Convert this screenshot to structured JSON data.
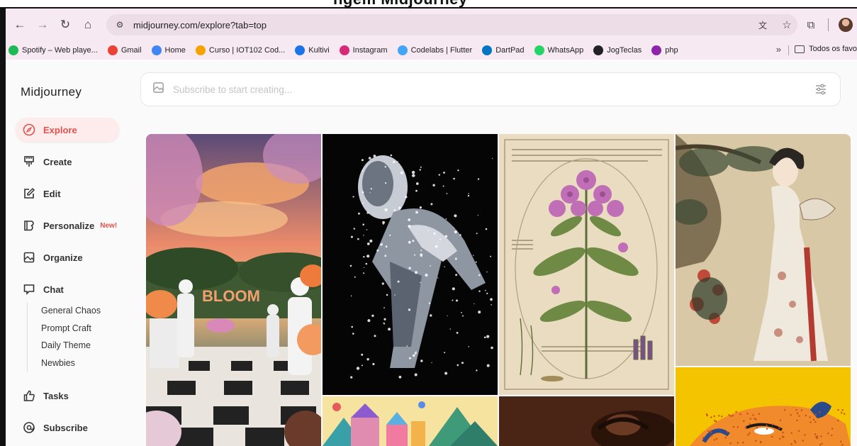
{
  "browser": {
    "url": "midjourney.com/explore?tab=top",
    "bookmarks": [
      {
        "label": "Spotify – Web playe...",
        "color": "#1db954"
      },
      {
        "label": "Gmail",
        "color": "#ea4335"
      },
      {
        "label": "Home",
        "color": "#4285f4"
      },
      {
        "label": "Curso | IOT102 Cod...",
        "color": "#f4a300"
      },
      {
        "label": "Kultivi",
        "color": "#1a73e8"
      },
      {
        "label": "Instagram",
        "color": "#d62976"
      },
      {
        "label": "Codelabs | Flutter",
        "color": "#42a5f5"
      },
      {
        "label": "DartPad",
        "color": "#0175c2"
      },
      {
        "label": "WhatsApp",
        "color": "#25d366"
      },
      {
        "label": "JogTeclas",
        "color": "#222222"
      },
      {
        "label": "php",
        "color": "#8e24aa"
      }
    ],
    "more": "»",
    "folder_label": "Todos os favo"
  },
  "sidebar": {
    "brand": "Midjourney",
    "items": [
      {
        "label": "Explore",
        "icon": "compass-icon"
      },
      {
        "label": "Create",
        "icon": "brush-icon"
      },
      {
        "label": "Edit",
        "icon": "edit-icon"
      },
      {
        "label": "Personalize",
        "icon": "personalize-icon",
        "badge": "New!"
      },
      {
        "label": "Organize",
        "icon": "image-icon"
      },
      {
        "label": "Chat",
        "icon": "chat-icon"
      },
      {
        "label": "Tasks",
        "icon": "thumbs-up-icon"
      },
      {
        "label": "Subscribe",
        "icon": "at-icon"
      }
    ],
    "chat_channels": [
      "General Chaos",
      "Prompt Craft",
      "Daily Theme",
      "Newbies"
    ]
  },
  "search": {
    "placeholder": "Subscribe to start creating..."
  },
  "gallery": {
    "bloom_text": "BLOOM"
  },
  "colors": {
    "accent": "#e2524b",
    "browser_bar": "#f6e9f1"
  }
}
